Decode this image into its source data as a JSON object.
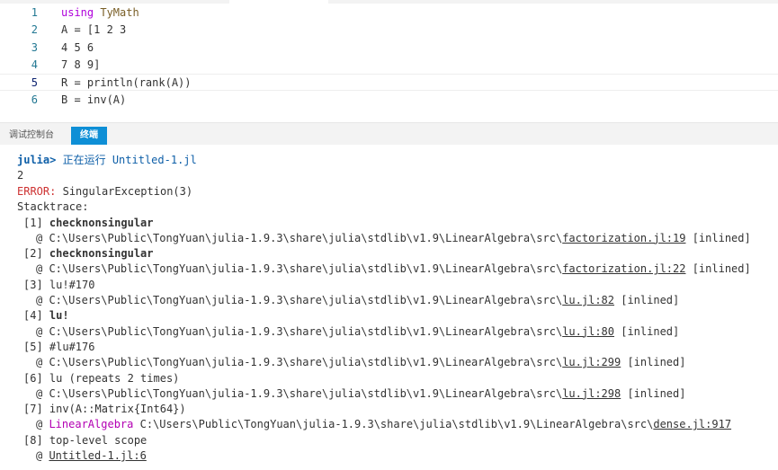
{
  "editor": {
    "lines": [
      {
        "n": "1",
        "parts": [
          {
            "t": "using",
            "c": "kw"
          },
          {
            "t": " TyMath",
            "c": "fn"
          }
        ]
      },
      {
        "n": "2",
        "parts": [
          {
            "t": "A = [1 2 3",
            "c": ""
          }
        ]
      },
      {
        "n": "3",
        "parts": [
          {
            "t": "4 5 6",
            "c": ""
          }
        ]
      },
      {
        "n": "4",
        "parts": [
          {
            "t": "7 8 9]",
            "c": ""
          }
        ]
      },
      {
        "n": "5",
        "parts": [
          {
            "t": "R = println(rank(A))",
            "c": ""
          }
        ]
      },
      {
        "n": "6",
        "parts": [
          {
            "t": "B = inv(A)",
            "c": ""
          }
        ]
      }
    ],
    "current_line": 5
  },
  "panel": {
    "tabs": [
      {
        "label": "调试控制台",
        "active": false
      },
      {
        "label": "终端",
        "active": true
      }
    ]
  },
  "terminal": {
    "prompt": "julia>",
    "command": "正在运行 Untitled-1.jl",
    "output": "2",
    "error_label": "ERROR:",
    "error_msg": "SingularException(3)",
    "stacktrace_label": "Stacktrace:",
    "frames": [
      {
        "idx": "[1]",
        "fn": "checknonsingular",
        "bold": true,
        "module": "",
        "path": "C:\\Users\\Public\\TongYuan\\julia-1.9.3\\share\\julia\\stdlib\\v1.9\\LinearAlgebra\\src\\",
        "file": "factorization.jl:19",
        "suffix": " [inlined]"
      },
      {
        "idx": "[2]",
        "fn": "checknonsingular",
        "bold": true,
        "module": "",
        "path": "C:\\Users\\Public\\TongYuan\\julia-1.9.3\\share\\julia\\stdlib\\v1.9\\LinearAlgebra\\src\\",
        "file": "factorization.jl:22",
        "suffix": " [inlined]"
      },
      {
        "idx": "[3]",
        "fn": "lu!#170",
        "bold": false,
        "module": "",
        "path": "C:\\Users\\Public\\TongYuan\\julia-1.9.3\\share\\julia\\stdlib\\v1.9\\LinearAlgebra\\src\\",
        "file": "lu.jl:82",
        "suffix": " [inlined]"
      },
      {
        "idx": "[4]",
        "fn": "lu!",
        "bold": true,
        "module": "",
        "path": "C:\\Users\\Public\\TongYuan\\julia-1.9.3\\share\\julia\\stdlib\\v1.9\\LinearAlgebra\\src\\",
        "file": "lu.jl:80",
        "suffix": " [inlined]"
      },
      {
        "idx": "[5]",
        "fn": "#lu#176",
        "bold": false,
        "module": "",
        "path": "C:\\Users\\Public\\TongYuan\\julia-1.9.3\\share\\julia\\stdlib\\v1.9\\LinearAlgebra\\src\\",
        "file": "lu.jl:299",
        "suffix": " [inlined]"
      },
      {
        "idx": "[6]",
        "fn": "lu (repeats 2 times)",
        "bold": false,
        "module": "",
        "path": "C:\\Users\\Public\\TongYuan\\julia-1.9.3\\share\\julia\\stdlib\\v1.9\\LinearAlgebra\\src\\",
        "file": "lu.jl:298",
        "suffix": " [inlined]"
      },
      {
        "idx": "[7]",
        "fn": "inv(A::Matrix{Int64})",
        "bold": false,
        "module": "LinearAlgebra ",
        "path": "C:\\Users\\Public\\TongYuan\\julia-1.9.3\\share\\julia\\stdlib\\v1.9\\LinearAlgebra\\src\\",
        "file": "dense.jl:917",
        "suffix": ""
      },
      {
        "idx": "[8]",
        "fn": "top-level scope",
        "bold": false,
        "module": "",
        "path": "",
        "file": "Untitled-1.jl:6",
        "suffix": ""
      }
    ]
  }
}
